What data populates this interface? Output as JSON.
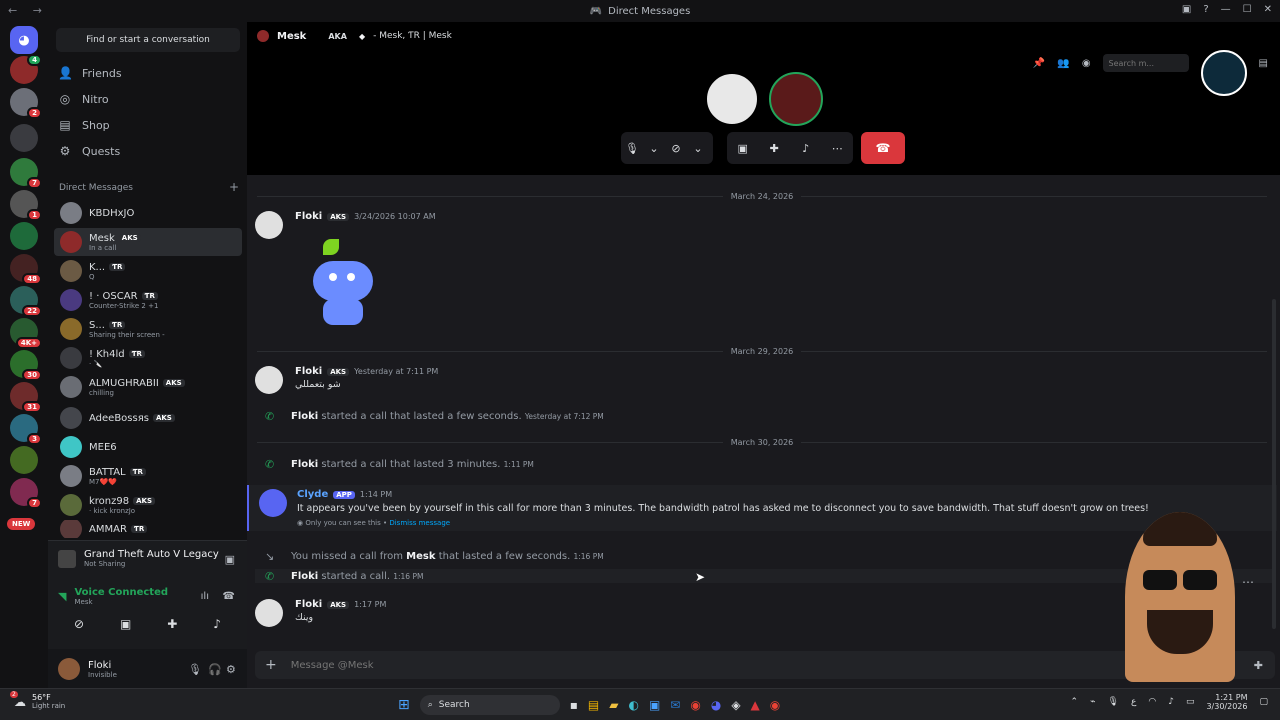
{
  "window": {
    "title": "Direct Messages"
  },
  "search": {
    "placeholder": "Find or start a conversation",
    "top_placeholder": "Search m..."
  },
  "nav": {
    "friends": "Friends",
    "nitro": "Nitro",
    "shop": "Shop",
    "quests": "Quests"
  },
  "dm_section": {
    "title": "Direct Messages",
    "add": "+"
  },
  "dms": [
    {
      "name": "KBDHxJO",
      "sub": "",
      "tag": ""
    },
    {
      "name": "Mesk",
      "sub": "In a call",
      "tag": "AKS"
    },
    {
      "name": "K...",
      "sub": "Q",
      "tag": "ƬR"
    },
    {
      "name": "! · OSCAR",
      "sub": "Counter-Strike 2 +1",
      "tag": "ƬR"
    },
    {
      "name": "S...",
      "sub": "Sharing their screen -",
      "tag": "ƬR"
    },
    {
      "name": "! Kh4ld",
      "sub": "· 🔪",
      "tag": "ƬR"
    },
    {
      "name": "ALMUGHRABII",
      "sub": "chilling",
      "tag": "AKS"
    },
    {
      "name": "AdeeBossяs",
      "sub": "",
      "tag": "AKS"
    },
    {
      "name": "MEE6",
      "sub": "",
      "tag": ""
    },
    {
      "name": "BATTAL",
      "sub": "M7❤️❤️",
      "tag": "ƬR"
    },
    {
      "name": "kronz98",
      "sub": "· kick kronzJo",
      "tag": "AKS"
    },
    {
      "name": "AMMAR",
      "sub": "",
      "tag": "ƬR"
    }
  ],
  "activity": {
    "game": "Grand Theft Auto V Legacy",
    "game_status": "Not Sharing",
    "voice": "Voice Connected",
    "voice_channel": "Mesk"
  },
  "user": {
    "name": "Floki",
    "status": "Invisible"
  },
  "header": {
    "name": "Mesk",
    "aka_label": "AKA",
    "aka": "- Mesk, ƬR | Mesk"
  },
  "server_badges": [
    "2",
    "7",
    "1",
    "48",
    "22",
    "4K+",
    "30",
    "31",
    "3",
    "7"
  ],
  "new_pill": "NEW",
  "chat": {
    "date1": "March 24, 2026",
    "m1_author": "Floki",
    "m1_tag": "AKS",
    "m1_time": "3/24/2026 10:07 AM",
    "date2": "March 29, 2026",
    "m2_author": "Floki",
    "m2_tag": "AKS",
    "m2_time": "Yesterday at 7:11 PM",
    "m2_body": "شو بتعمللي",
    "s1_author": "Floki",
    "s1_text": "started a call that lasted a few seconds.",
    "s1_time": "Yesterday at 7:12 PM",
    "date3": "March 30, 2026",
    "s2_author": "Floki",
    "s2_text": "started a call that lasted 3 minutes.",
    "s2_time": "1:11 PM",
    "m3_author": "Clyde",
    "m3_tag": "APP",
    "m3_time": "1:14 PM",
    "m3_body": "It appears you've been by yourself in this call for more than 3 minutes. The bandwidth patrol has asked me to disconnect you to save bandwidth. That stuff doesn't grow on trees!",
    "m3_note": "Only you can see this •",
    "m3_dismiss": "Dismiss message",
    "s3_pre": "You missed a call from",
    "s3_author": "Mesk",
    "s3_text": "that lasted a few seconds.",
    "s3_time": "1:16 PM",
    "s4_author": "Floki",
    "s4_text": "started a call.",
    "s4_time": "1:16 PM",
    "m4_author": "Floki",
    "m4_tag": "AKS",
    "m4_time": "1:17 PM",
    "m4_body": "وينك"
  },
  "composer": {
    "placeholder": "Message @Mesk"
  },
  "taskbar": {
    "temp": "56°F",
    "weather": "Light rain",
    "weather_badge": "2",
    "search": "Search",
    "time": "1:21 PM",
    "date": "3/30/2026",
    "lang": "ع"
  },
  "colors": {
    "accent": "#5865f2",
    "danger": "#da373c",
    "online": "#23a55a",
    "link": "#00a8fc"
  }
}
